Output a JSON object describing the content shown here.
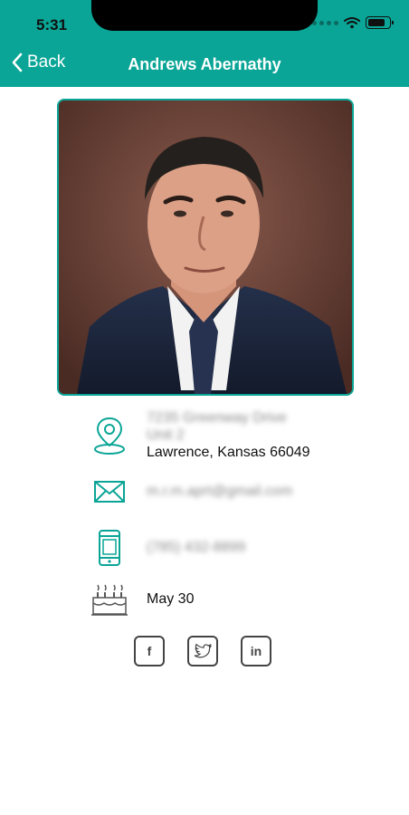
{
  "status": {
    "time": "5:31"
  },
  "nav": {
    "back_label": "Back",
    "title": "Andrews Abernathy"
  },
  "contact": {
    "address_line1": "7235 Greenway Drive",
    "address_line2": "Unit 2",
    "address_city": "Lawrence, Kansas 66049",
    "email": "m.r.m.aprt@gmail.com",
    "phone": "(785) 432-8899",
    "birthday": "May 30"
  },
  "social": {
    "facebook_label": "f",
    "twitter_label": "t",
    "linkedin_label": "in"
  },
  "colors": {
    "accent": "#0aa596",
    "text": "#111111"
  }
}
